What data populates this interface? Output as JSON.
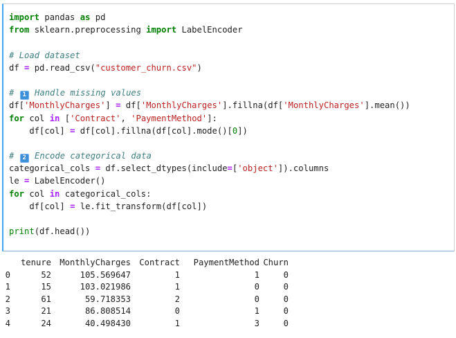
{
  "code": {
    "lines": [
      [
        {
          "t": "import",
          "c": "kw"
        },
        {
          "t": " pandas ",
          "c": "tx"
        },
        {
          "t": "as",
          "c": "kw"
        },
        {
          "t": " pd",
          "c": "tx"
        }
      ],
      [
        {
          "t": "from",
          "c": "kw"
        },
        {
          "t": " sklearn.preprocessing ",
          "c": "tx"
        },
        {
          "t": "import",
          "c": "kw"
        },
        {
          "t": " LabelEncoder",
          "c": "tx"
        }
      ],
      [],
      [
        {
          "t": "# Load dataset",
          "c": "cm"
        }
      ],
      [
        {
          "t": "df ",
          "c": "tx"
        },
        {
          "t": "=",
          "c": "op"
        },
        {
          "t": " pd.read_csv(",
          "c": "tx"
        },
        {
          "t": "\"customer_churn.csv\"",
          "c": "st"
        },
        {
          "t": ")",
          "c": "tx"
        }
      ],
      [],
      [
        {
          "t": "# ",
          "c": "cm"
        },
        {
          "badge": "1"
        },
        {
          "t": " Handle missing values",
          "c": "cm"
        }
      ],
      [
        {
          "t": "df[",
          "c": "tx"
        },
        {
          "t": "'MonthlyCharges'",
          "c": "st"
        },
        {
          "t": "] ",
          "c": "tx"
        },
        {
          "t": "=",
          "c": "op"
        },
        {
          "t": " df[",
          "c": "tx"
        },
        {
          "t": "'MonthlyCharges'",
          "c": "st"
        },
        {
          "t": "].fillna(df[",
          "c": "tx"
        },
        {
          "t": "'MonthlyCharges'",
          "c": "st"
        },
        {
          "t": "].mean())",
          "c": "tx"
        }
      ],
      [
        {
          "t": "for",
          "c": "kw"
        },
        {
          "t": " col ",
          "c": "tx"
        },
        {
          "t": "in",
          "c": "op"
        },
        {
          "t": " [",
          "c": "tx"
        },
        {
          "t": "'Contract'",
          "c": "st"
        },
        {
          "t": ", ",
          "c": "tx"
        },
        {
          "t": "'PaymentMethod'",
          "c": "st"
        },
        {
          "t": "]:",
          "c": "tx"
        }
      ],
      [
        {
          "t": "    df[col] ",
          "c": "tx"
        },
        {
          "t": "=",
          "c": "op"
        },
        {
          "t": " df[col].fillna(df[col].mode()[",
          "c": "tx"
        },
        {
          "t": "0",
          "c": "nm"
        },
        {
          "t": "])",
          "c": "tx"
        }
      ],
      [],
      [
        {
          "t": "# ",
          "c": "cm"
        },
        {
          "badge": "2"
        },
        {
          "t": " Encode categorical data",
          "c": "cm"
        }
      ],
      [
        {
          "t": "categorical_cols ",
          "c": "tx"
        },
        {
          "t": "=",
          "c": "op"
        },
        {
          "t": " df.select_dtypes(include",
          "c": "tx"
        },
        {
          "t": "=",
          "c": "op"
        },
        {
          "t": "[",
          "c": "tx"
        },
        {
          "t": "'object'",
          "c": "st"
        },
        {
          "t": "]).columns",
          "c": "tx"
        }
      ],
      [
        {
          "t": "le ",
          "c": "tx"
        },
        {
          "t": "=",
          "c": "op"
        },
        {
          "t": " LabelEncoder()",
          "c": "tx"
        }
      ],
      [
        {
          "t": "for",
          "c": "kw"
        },
        {
          "t": " col ",
          "c": "tx"
        },
        {
          "t": "in",
          "c": "op"
        },
        {
          "t": " categorical_cols:",
          "c": "tx"
        }
      ],
      [
        {
          "t": "    df[col] ",
          "c": "tx"
        },
        {
          "t": "=",
          "c": "op"
        },
        {
          "t": " le.fit_transform(df[col])",
          "c": "tx"
        }
      ],
      [],
      [
        {
          "t": "print",
          "c": "nm"
        },
        {
          "t": "(df.head())",
          "c": "tx"
        }
      ]
    ]
  },
  "output": {
    "columns": [
      "",
      "tenure",
      "MonthlyCharges",
      "Contract",
      "PaymentMethod",
      "Churn"
    ],
    "rows": [
      [
        "0",
        "52",
        "105.569647",
        "1",
        "1",
        "0"
      ],
      [
        "1",
        "15",
        "103.021986",
        "1",
        "0",
        "0"
      ],
      [
        "2",
        "61",
        "59.718353",
        "2",
        "0",
        "0"
      ],
      [
        "3",
        "21",
        "86.808514",
        "0",
        "1",
        "0"
      ],
      [
        "4",
        "24",
        "40.498430",
        "1",
        "3",
        "0"
      ]
    ]
  }
}
